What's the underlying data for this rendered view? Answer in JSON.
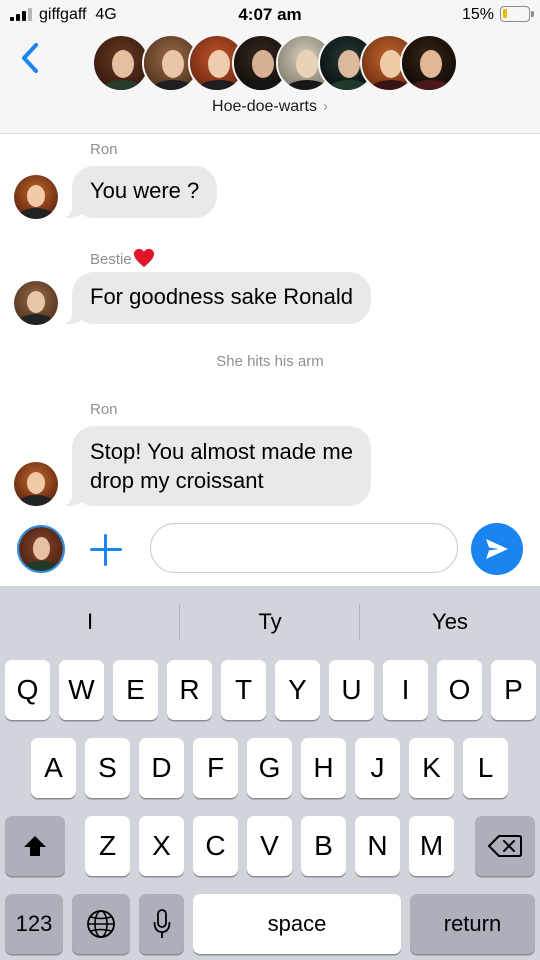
{
  "status_bar": {
    "carrier": "giffgaff",
    "network": "4G",
    "time": "4:07 am",
    "battery_percent": "15%",
    "battery_level": 0.15
  },
  "header": {
    "group_name": "Hoe-doe-warts",
    "back_icon": "chevron-left-icon",
    "disclosure_icon": "chevron-right-icon",
    "member_count_shown": 8
  },
  "messages": [
    {
      "sender": "Ron",
      "text": "You were ?"
    },
    {
      "sender": "Bestie",
      "sender_emoji": "red-heart-icon",
      "text": "For goodness sake Ronald"
    },
    {
      "note": "She hits his arm"
    },
    {
      "sender": "Ron",
      "lines": [
        "Stop! You almost made me",
        "drop my croissant"
      ]
    }
  ],
  "composer": {
    "placeholder": "",
    "value": "",
    "plus_icon": "plus-icon",
    "send_icon": "send-arrow-icon"
  },
  "keyboard": {
    "predictions": [
      "I",
      "Ty",
      "Yes"
    ],
    "row1": [
      "Q",
      "W",
      "E",
      "R",
      "T",
      "Y",
      "U",
      "I",
      "O",
      "P"
    ],
    "row2": [
      "A",
      "S",
      "D",
      "F",
      "G",
      "H",
      "J",
      "K",
      "L"
    ],
    "row3": [
      "Z",
      "X",
      "C",
      "V",
      "B",
      "N",
      "M"
    ],
    "numbers_key": "123",
    "space_key": "space",
    "return_key": "return",
    "shift_icon": "shift-icon",
    "delete_icon": "backspace-icon",
    "globe_icon": "globe-icon",
    "mic_icon": "microphone-icon"
  },
  "colors": {
    "accent": "#1a84f0",
    "incoming_bubble": "#e9e9eb",
    "keyboard_bg": "#d1d4da",
    "battery_low": "#f2b705"
  }
}
